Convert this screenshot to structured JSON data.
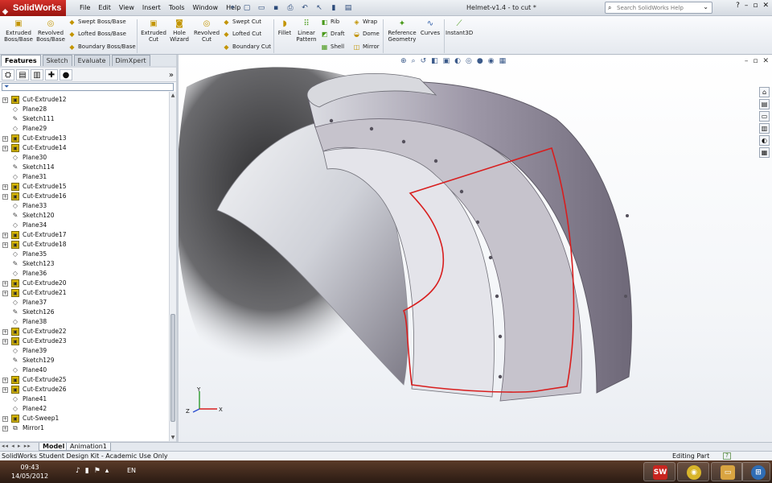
{
  "app": {
    "logo_text": "SolidWorks",
    "doc_title": "Helmet-v1.4 - to cut *"
  },
  "menu": [
    "File",
    "Edit",
    "View",
    "Insert",
    "Tools",
    "Window",
    "Help"
  ],
  "search": {
    "placeholder": "Search SolidWorks Help"
  },
  "ribbon": {
    "extruded_boss": "Extruded Boss/Base",
    "revolved_boss": "Revolved Boss/Base",
    "swept_boss": "Swept Boss/Base",
    "lofted_boss": "Lofted Boss/Base",
    "boundary_boss": "Boundary Boss/Base",
    "extruded_cut": "Extruded Cut",
    "hole_wizard": "Hole Wizard",
    "revolved_cut": "Revolved Cut",
    "swept_cut": "Swept Cut",
    "lofted_cut": "Lofted Cut",
    "boundary_cut": "Boundary Cut",
    "fillet": "Fillet",
    "linear_pattern": "Linear Pattern",
    "rib": "Rib",
    "draft": "Draft",
    "shell": "Shell",
    "wrap": "Wrap",
    "dome": "Dome",
    "mirror": "Mirror",
    "reference_geometry": "Reference Geometry",
    "curves": "Curves",
    "instant3d": "Instant3D"
  },
  "manager_tabs": [
    "Features",
    "Sketch",
    "Evaluate",
    "DimXpert"
  ],
  "feature_tree": [
    {
      "label": "Cut-Extrude12",
      "type": "cut"
    },
    {
      "label": "Plane28",
      "type": "plane"
    },
    {
      "label": "Sketch111",
      "type": "sketch"
    },
    {
      "label": "Plane29",
      "type": "plane"
    },
    {
      "label": "Cut-Extrude13",
      "type": "cut"
    },
    {
      "label": "Cut-Extrude14",
      "type": "cut"
    },
    {
      "label": "Plane30",
      "type": "plane"
    },
    {
      "label": "Sketch114",
      "type": "sketch"
    },
    {
      "label": "Plane31",
      "type": "plane"
    },
    {
      "label": "Cut-Extrude15",
      "type": "cut"
    },
    {
      "label": "Cut-Extrude16",
      "type": "cut"
    },
    {
      "label": "Plane33",
      "type": "plane"
    },
    {
      "label": "Sketch120",
      "type": "sketch"
    },
    {
      "label": "Plane34",
      "type": "plane"
    },
    {
      "label": "Cut-Extrude17",
      "type": "cut"
    },
    {
      "label": "Cut-Extrude18",
      "type": "cut"
    },
    {
      "label": "Plane35",
      "type": "plane"
    },
    {
      "label": "Sketch123",
      "type": "sketch"
    },
    {
      "label": "Plane36",
      "type": "plane"
    },
    {
      "label": "Cut-Extrude20",
      "type": "cut"
    },
    {
      "label": "Cut-Extrude21",
      "type": "cut"
    },
    {
      "label": "Plane37",
      "type": "plane"
    },
    {
      "label": "Sketch126",
      "type": "sketch"
    },
    {
      "label": "Plane38",
      "type": "plane"
    },
    {
      "label": "Cut-Extrude22",
      "type": "cut"
    },
    {
      "label": "Cut-Extrude23",
      "type": "cut"
    },
    {
      "label": "Plane39",
      "type": "plane"
    },
    {
      "label": "Sketch129",
      "type": "sketch"
    },
    {
      "label": "Plane40",
      "type": "plane"
    },
    {
      "label": "Cut-Extrude25",
      "type": "cut"
    },
    {
      "label": "Cut-Extrude26",
      "type": "cut"
    },
    {
      "label": "Plane41",
      "type": "plane"
    },
    {
      "label": "Plane42",
      "type": "plane"
    },
    {
      "label": "Cut-Sweep1",
      "type": "cut"
    },
    {
      "label": "Mirror1",
      "type": "mirror"
    }
  ],
  "bottom_tabs": [
    "Model",
    "Animation1"
  ],
  "status": {
    "left": "SolidWorks Student Design Kit - Academic Use Only",
    "right": "Editing Part"
  },
  "triad": {
    "x": "X",
    "y": "Y",
    "z": "Z"
  },
  "taskbar": {
    "time": "09:43",
    "date": "14/05/2012",
    "lang": "EN"
  },
  "colors": {
    "brand": "#c8251f",
    "sketch_outline": "#d81e1e",
    "tree_bg": "#ffffff"
  }
}
